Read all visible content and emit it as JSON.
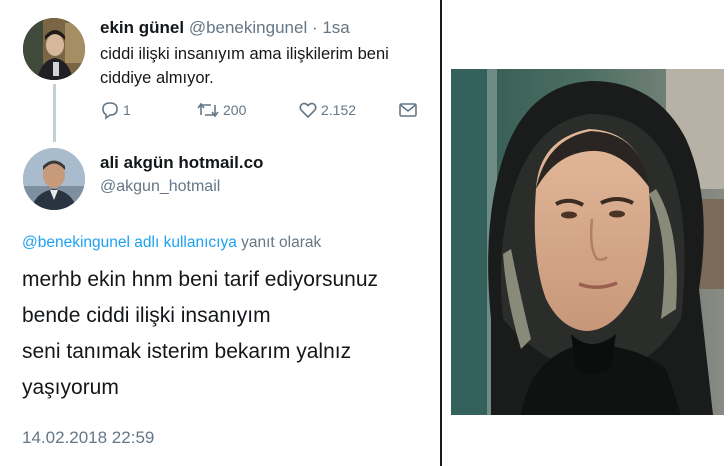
{
  "tweet": {
    "author_name": "ekin günel",
    "author_handle": "@benekingunel",
    "time": "· 1sa",
    "text": "ciddi ilişki insanıyım ama ilişkilerim beni ciddiye almıyor.",
    "actions": {
      "replies": "1",
      "retweets": "200",
      "likes": "2.152"
    }
  },
  "reply": {
    "author_name": "ali akgün hotmail.co",
    "author_handle": "@akgun_hotmail",
    "replying_mention": "@benekingunel",
    "replying_suffix": "adlı kullanıcıya",
    "replying_tail": "yanıt olarak",
    "lines": [
      "merhb ekin hnm beni tarif ediyorsunuz",
      "bende ciddi  ilişki insanıyım",
      "seni tanımak isterim bekarım yalnız",
      "yaşıyorum"
    ],
    "timestamp": "14.02.2018 22:59"
  },
  "colors": {
    "accent": "#1da1f2",
    "muted": "#657786",
    "text": "#14171a"
  },
  "icons": [
    "reply-icon",
    "retweet-icon",
    "like-icon",
    "message-icon"
  ]
}
